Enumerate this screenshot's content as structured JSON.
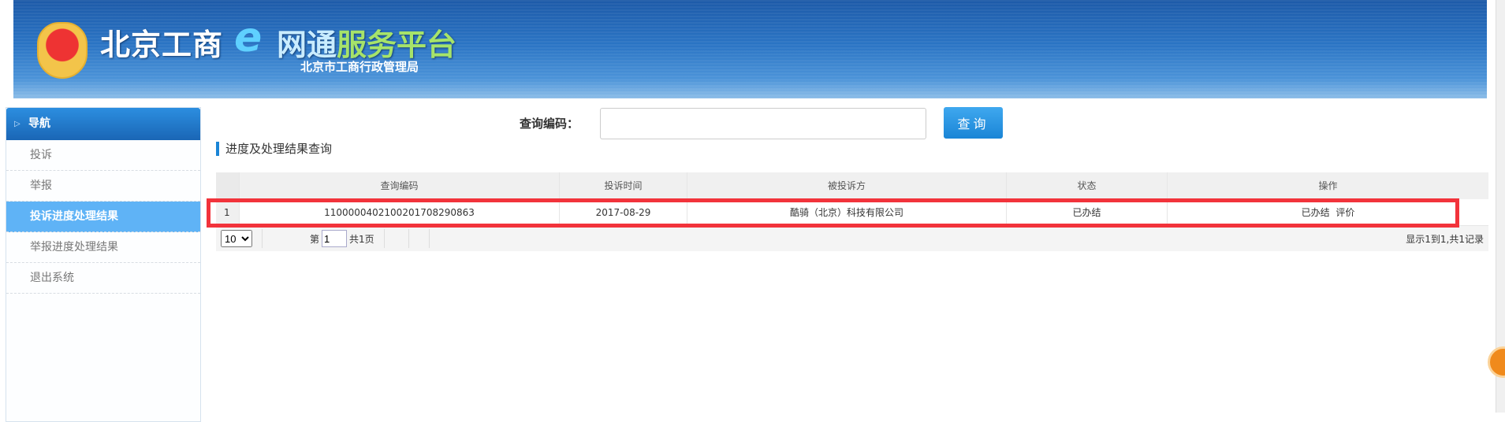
{
  "header": {
    "title_main": "北京工商",
    "title_e": "e",
    "title_rest_a": "网通",
    "title_rest_b": "服务平台",
    "subtitle": "北京市工商行政管理局"
  },
  "sidebar": {
    "heading": "导航",
    "items": [
      {
        "label": "投诉"
      },
      {
        "label": "举报"
      },
      {
        "label": "投诉进度处理结果",
        "active": true
      },
      {
        "label": "举报进度处理结果"
      },
      {
        "label": "退出系统"
      }
    ]
  },
  "search": {
    "label": "查询编码：",
    "value": "",
    "button": "查询"
  },
  "section_title": "进度及处理结果查询",
  "table": {
    "columns": [
      "查询编码",
      "投诉时间",
      "被投诉方",
      "状态",
      "操作"
    ],
    "rows": [
      {
        "index": "1",
        "code": "11000004021002017082908​63",
        "time": "2017-08-29",
        "party": "酷骑（北京）科技有限公司",
        "status": "已办结",
        "action_status": "已办结",
        "action_link": "评价"
      }
    ]
  },
  "pager": {
    "page_size": "10",
    "page_prefix": "第",
    "page": "1",
    "page_suffix": "共1页",
    "info": "显示1到1,共1记录"
  },
  "colors": {
    "accent": "#1a85d6",
    "highlight": "#f2333b",
    "active_nav": "#5fb3f6"
  }
}
